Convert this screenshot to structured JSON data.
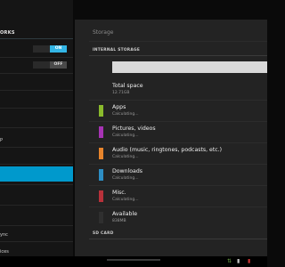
{
  "left": {
    "header": "ORKS",
    "toggle_on_label": "ON",
    "toggle_off_label": "OFF",
    "item_p": "P",
    "item_sync": "ync",
    "item_ices": "ices"
  },
  "right": {
    "title": "Storage",
    "internal_header": "INTERNAL STORAGE",
    "sdcard_header": "SD CARD",
    "total_space": {
      "title": "Total space",
      "value": "12.71GB"
    },
    "items": [
      {
        "title": "Apps",
        "sub": "Calculating...",
        "color": "#8aba2c"
      },
      {
        "title": "Pictures, videos",
        "sub": "Calculating...",
        "color": "#a733b4"
      },
      {
        "title": "Audio (music, ringtones, podcasts, etc.)",
        "sub": "Calculating...",
        "color": "#e8852c"
      },
      {
        "title": "Downloads",
        "sub": "Calculating...",
        "color": "#2d8ec4"
      },
      {
        "title": "Misc.",
        "sub": "Calculating...",
        "color": "#b8313a"
      },
      {
        "title": "Available",
        "sub": "838MB",
        "color": "#2f2f2f"
      }
    ]
  },
  "icons": [
    "network-icon",
    "signal-icon",
    "battery-icon"
  ]
}
